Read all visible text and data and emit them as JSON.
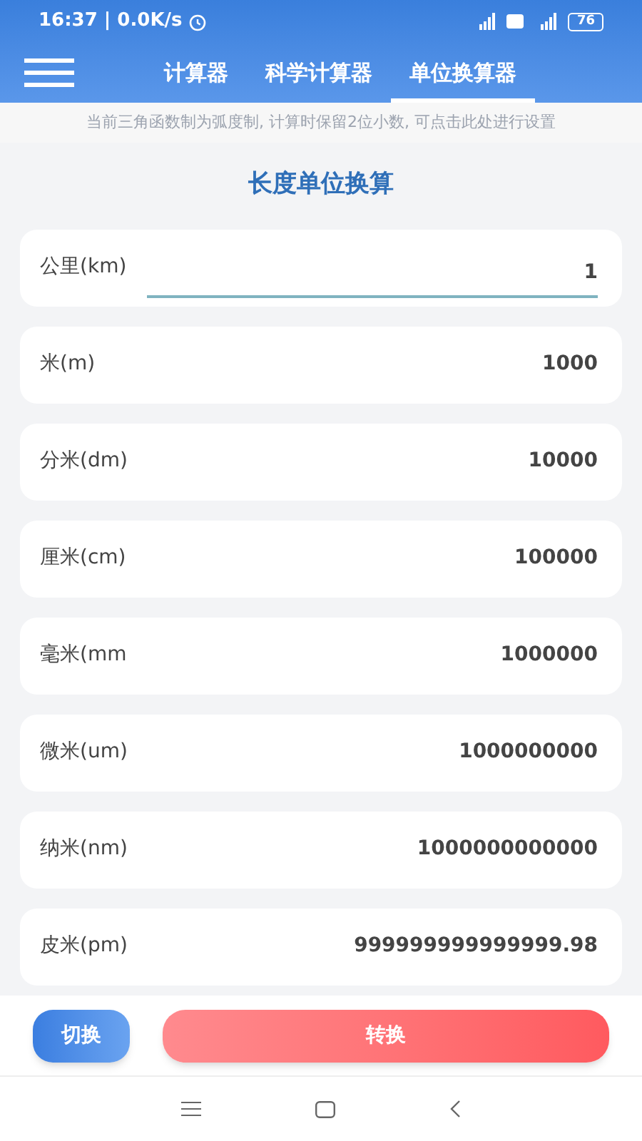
{
  "status_bar": {
    "time": "16:37 | 0.0K/s",
    "battery": "76"
  },
  "tabs": [
    {
      "label": "计算器",
      "selected": false
    },
    {
      "label": "科学计算器",
      "selected": false
    },
    {
      "label": "单位换算器",
      "selected": true
    }
  ],
  "notice": "当前三角函数制为弧度制, 计算时保留2位小数, 可点击此处进行设置",
  "title": "长度单位换算",
  "units": [
    {
      "kind": "input",
      "label": "公里(km)",
      "value": "1"
    },
    {
      "kind": "result",
      "label": "米(m)",
      "value": "1000"
    },
    {
      "kind": "result",
      "label": "分米(dm)",
      "value": "10000"
    },
    {
      "kind": "result",
      "label": "厘米(cm)",
      "value": "100000"
    },
    {
      "kind": "result",
      "label": "毫米(mm",
      "value": "1000000"
    },
    {
      "kind": "result",
      "label": "微米(um)",
      "value": "1000000000"
    },
    {
      "kind": "result",
      "label": "纳米(nm)",
      "value": "1000000000000"
    },
    {
      "kind": "result",
      "label": "皮米(pm)",
      "value": "999999999999999.98"
    }
  ],
  "buttons": [
    {
      "kind": "switch",
      "label": "切换"
    },
    {
      "kind": "convert",
      "label": "转换"
    }
  ]
}
